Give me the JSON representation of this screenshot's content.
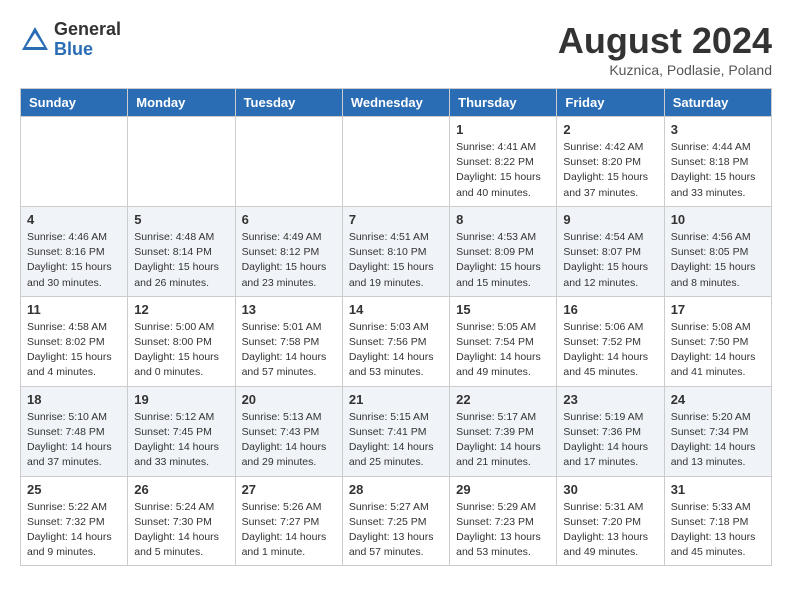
{
  "header": {
    "logo_general": "General",
    "logo_blue": "Blue",
    "month_year": "August 2024",
    "location": "Kuznica, Podlasie, Poland"
  },
  "weekdays": [
    "Sunday",
    "Monday",
    "Tuesday",
    "Wednesday",
    "Thursday",
    "Friday",
    "Saturday"
  ],
  "weeks": [
    {
      "days": [
        {
          "num": "",
          "info": ""
        },
        {
          "num": "",
          "info": ""
        },
        {
          "num": "",
          "info": ""
        },
        {
          "num": "",
          "info": ""
        },
        {
          "num": "1",
          "info": "Sunrise: 4:41 AM\nSunset: 8:22 PM\nDaylight: 15 hours\nand 40 minutes."
        },
        {
          "num": "2",
          "info": "Sunrise: 4:42 AM\nSunset: 8:20 PM\nDaylight: 15 hours\nand 37 minutes."
        },
        {
          "num": "3",
          "info": "Sunrise: 4:44 AM\nSunset: 8:18 PM\nDaylight: 15 hours\nand 33 minutes."
        }
      ]
    },
    {
      "days": [
        {
          "num": "4",
          "info": "Sunrise: 4:46 AM\nSunset: 8:16 PM\nDaylight: 15 hours\nand 30 minutes."
        },
        {
          "num": "5",
          "info": "Sunrise: 4:48 AM\nSunset: 8:14 PM\nDaylight: 15 hours\nand 26 minutes."
        },
        {
          "num": "6",
          "info": "Sunrise: 4:49 AM\nSunset: 8:12 PM\nDaylight: 15 hours\nand 23 minutes."
        },
        {
          "num": "7",
          "info": "Sunrise: 4:51 AM\nSunset: 8:10 PM\nDaylight: 15 hours\nand 19 minutes."
        },
        {
          "num": "8",
          "info": "Sunrise: 4:53 AM\nSunset: 8:09 PM\nDaylight: 15 hours\nand 15 minutes."
        },
        {
          "num": "9",
          "info": "Sunrise: 4:54 AM\nSunset: 8:07 PM\nDaylight: 15 hours\nand 12 minutes."
        },
        {
          "num": "10",
          "info": "Sunrise: 4:56 AM\nSunset: 8:05 PM\nDaylight: 15 hours\nand 8 minutes."
        }
      ]
    },
    {
      "days": [
        {
          "num": "11",
          "info": "Sunrise: 4:58 AM\nSunset: 8:02 PM\nDaylight: 15 hours\nand 4 minutes."
        },
        {
          "num": "12",
          "info": "Sunrise: 5:00 AM\nSunset: 8:00 PM\nDaylight: 15 hours\nand 0 minutes."
        },
        {
          "num": "13",
          "info": "Sunrise: 5:01 AM\nSunset: 7:58 PM\nDaylight: 14 hours\nand 57 minutes."
        },
        {
          "num": "14",
          "info": "Sunrise: 5:03 AM\nSunset: 7:56 PM\nDaylight: 14 hours\nand 53 minutes."
        },
        {
          "num": "15",
          "info": "Sunrise: 5:05 AM\nSunset: 7:54 PM\nDaylight: 14 hours\nand 49 minutes."
        },
        {
          "num": "16",
          "info": "Sunrise: 5:06 AM\nSunset: 7:52 PM\nDaylight: 14 hours\nand 45 minutes."
        },
        {
          "num": "17",
          "info": "Sunrise: 5:08 AM\nSunset: 7:50 PM\nDaylight: 14 hours\nand 41 minutes."
        }
      ]
    },
    {
      "days": [
        {
          "num": "18",
          "info": "Sunrise: 5:10 AM\nSunset: 7:48 PM\nDaylight: 14 hours\nand 37 minutes."
        },
        {
          "num": "19",
          "info": "Sunrise: 5:12 AM\nSunset: 7:45 PM\nDaylight: 14 hours\nand 33 minutes."
        },
        {
          "num": "20",
          "info": "Sunrise: 5:13 AM\nSunset: 7:43 PM\nDaylight: 14 hours\nand 29 minutes."
        },
        {
          "num": "21",
          "info": "Sunrise: 5:15 AM\nSunset: 7:41 PM\nDaylight: 14 hours\nand 25 minutes."
        },
        {
          "num": "22",
          "info": "Sunrise: 5:17 AM\nSunset: 7:39 PM\nDaylight: 14 hours\nand 21 minutes."
        },
        {
          "num": "23",
          "info": "Sunrise: 5:19 AM\nSunset: 7:36 PM\nDaylight: 14 hours\nand 17 minutes."
        },
        {
          "num": "24",
          "info": "Sunrise: 5:20 AM\nSunset: 7:34 PM\nDaylight: 14 hours\nand 13 minutes."
        }
      ]
    },
    {
      "days": [
        {
          "num": "25",
          "info": "Sunrise: 5:22 AM\nSunset: 7:32 PM\nDaylight: 14 hours\nand 9 minutes."
        },
        {
          "num": "26",
          "info": "Sunrise: 5:24 AM\nSunset: 7:30 PM\nDaylight: 14 hours\nand 5 minutes."
        },
        {
          "num": "27",
          "info": "Sunrise: 5:26 AM\nSunset: 7:27 PM\nDaylight: 14 hours\nand 1 minute."
        },
        {
          "num": "28",
          "info": "Sunrise: 5:27 AM\nSunset: 7:25 PM\nDaylight: 13 hours\nand 57 minutes."
        },
        {
          "num": "29",
          "info": "Sunrise: 5:29 AM\nSunset: 7:23 PM\nDaylight: 13 hours\nand 53 minutes."
        },
        {
          "num": "30",
          "info": "Sunrise: 5:31 AM\nSunset: 7:20 PM\nDaylight: 13 hours\nand 49 minutes."
        },
        {
          "num": "31",
          "info": "Sunrise: 5:33 AM\nSunset: 7:18 PM\nDaylight: 13 hours\nand 45 minutes."
        }
      ]
    }
  ]
}
